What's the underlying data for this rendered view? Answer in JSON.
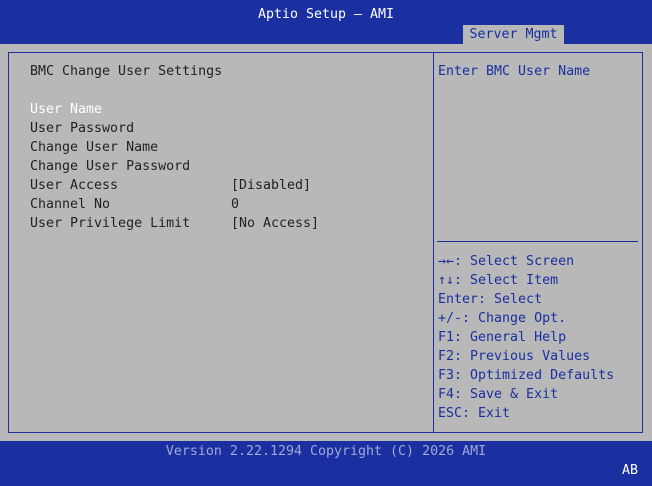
{
  "header": {
    "title": "Aptio Setup – AMI",
    "active_tab": "Server Mgmt"
  },
  "main": {
    "heading": "BMC Change User Settings",
    "items": [
      {
        "label": "User Name",
        "value": ""
      },
      {
        "label": "User Password",
        "value": ""
      },
      {
        "label": "Change User Name",
        "value": ""
      },
      {
        "label": "Change User Password",
        "value": ""
      },
      {
        "label": "User Access",
        "value": "[Disabled]"
      },
      {
        "label": "Channel No",
        "value": "0"
      },
      {
        "label": "User Privilege Limit",
        "value": "[No Access]"
      }
    ]
  },
  "help": {
    "description": "Enter BMC User Name",
    "keys": [
      "→←: Select Screen",
      "↑↓: Select Item",
      "Enter: Select",
      "+/-: Change Opt.",
      "F1: General Help",
      "F2: Previous Values",
      "F3: Optimized Defaults",
      "F4: Save & Exit",
      "ESC: Exit"
    ]
  },
  "footer": {
    "version": "Version 2.22.1294 Copyright (C) 2026 AMI",
    "badge": "AB"
  },
  "colors": {
    "accent": "#1a2fa0",
    "panel": "#b8b8b8",
    "selected_text": "#ffffff"
  }
}
